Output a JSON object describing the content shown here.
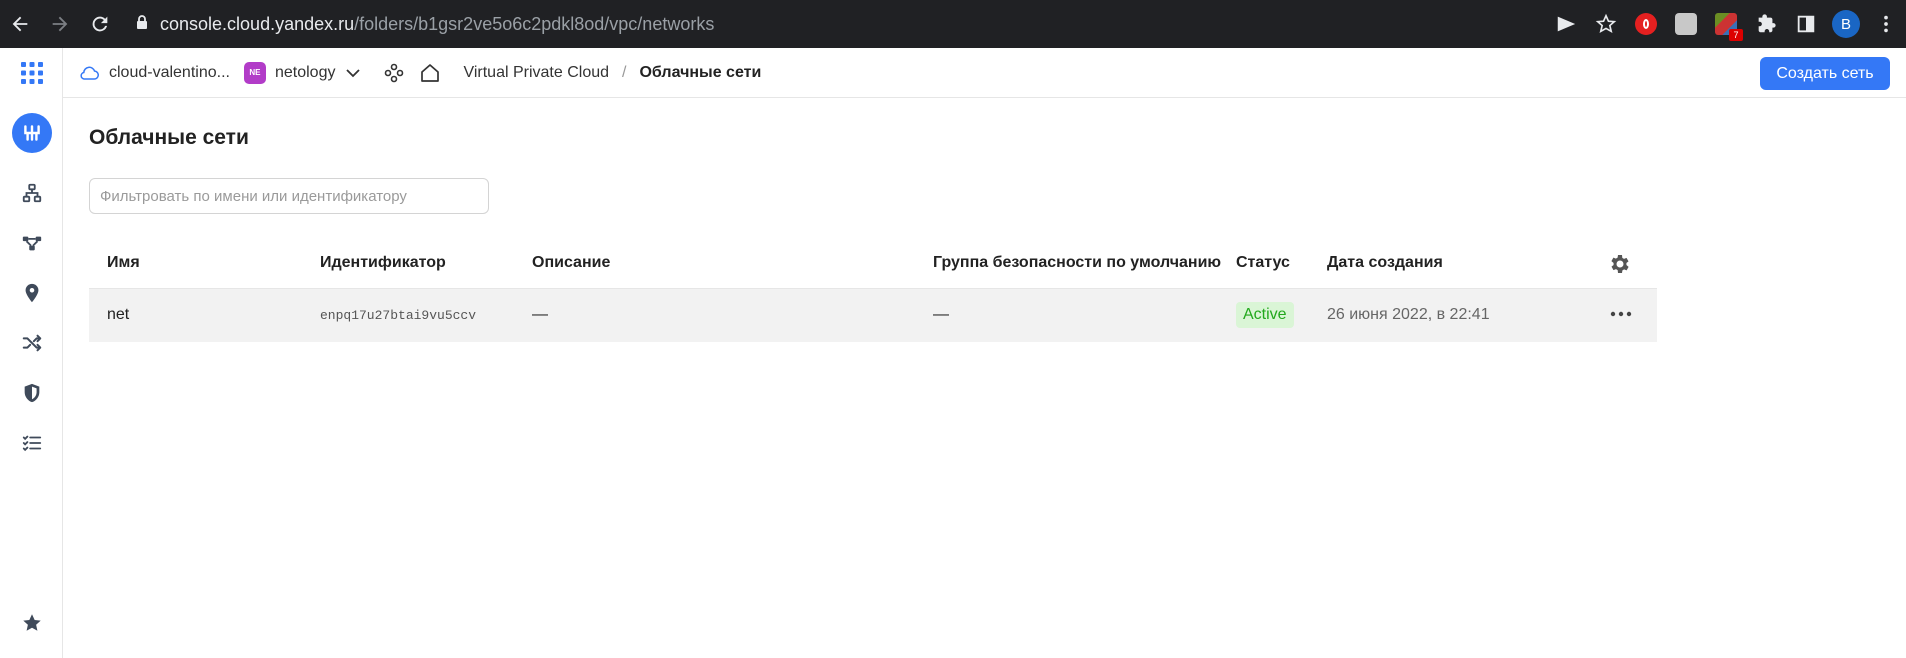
{
  "browser": {
    "url_domain": "console.cloud.yandex.ru",
    "url_path": "/folders/b1gsr2ve5o6c2pdkl8od/vpc/networks",
    "avatar_letter": "B",
    "ext_badge": "7"
  },
  "header": {
    "cloud_name": "cloud-valentino...",
    "folder_badge": "NE",
    "folder_name": "netology",
    "service": "Virtual Private Cloud",
    "separator": "/",
    "current": "Облачные сети",
    "create_button": "Создать сеть"
  },
  "page": {
    "title": "Облачные сети",
    "filter_placeholder": "Фильтровать по имени или идентификатору"
  },
  "table": {
    "columns": {
      "name": "Имя",
      "id": "Идентификатор",
      "description": "Описание",
      "security_group": "Группа безопасности по умолчанию",
      "status": "Статус",
      "created": "Дата создания"
    },
    "rows": [
      {
        "name": "net",
        "id": "enpq17u27btai9vu5ccv",
        "description": "—",
        "security_group": "—",
        "status": "Active",
        "created": "26 июня 2022, в 22:41"
      }
    ]
  },
  "colors": {
    "accent": "#3478f6",
    "folder_badge": "#b23cc8",
    "status_active_bg": "#daf5d6",
    "status_active_text": "#22a81c"
  },
  "icons": {
    "rail": [
      "apps-grid-icon",
      "vpc-service-icon",
      "cloud-networks-icon",
      "route-tables-icon",
      "ip-addresses-icon",
      "gateways-icon",
      "security-groups-icon",
      "operations-icon",
      "favorites-star-icon"
    ]
  }
}
